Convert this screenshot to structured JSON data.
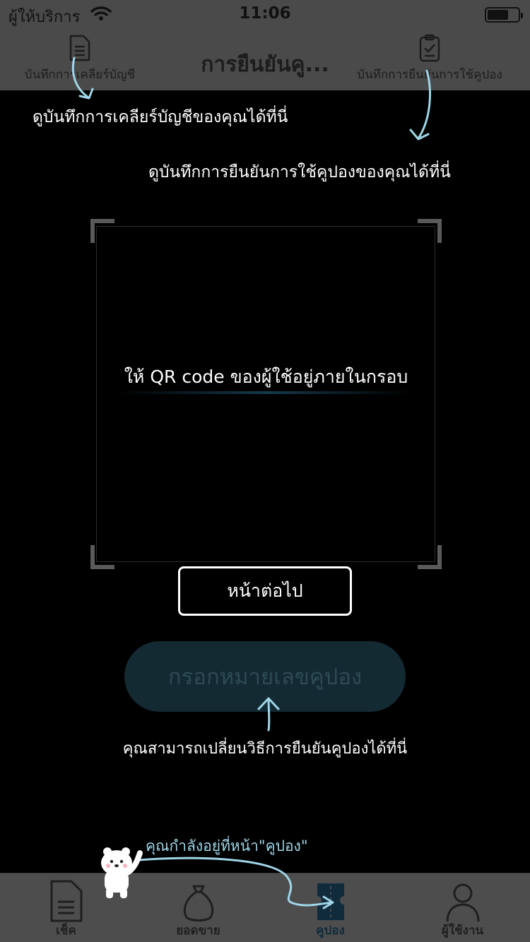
{
  "status_bar": {
    "carrier": "ผู้ให้บริการ",
    "time": "11:06",
    "battery_level_percent": 70
  },
  "nav": {
    "title": "การยืนยันคู...",
    "left_button_label": "บันทึกการเคลียร์บัญชี",
    "right_button_label": "บันทึกการยืนยันการใช้คูปอง",
    "left_icon": "document-icon",
    "right_icon": "clipboard-check-icon"
  },
  "hints": {
    "clear_records": "ดูบันทึกการเคลียร์บัญชีของคุณได้ที่นี่",
    "coupon_records": "ดูบันทึกการยืนยันการใช้คูปองของคุณได้ที่นี่",
    "change_method": "คุณสามารถเปลี่ยนวิธีการยืนยันคูปองได้ที่นี่",
    "current_page": "คุณกำลังอยู่ที่หน้า\"คูปอง\""
  },
  "scanner": {
    "instruction": "ให้ QR code ของผู้ใช้อยู่ภายในกรอบ"
  },
  "buttons": {
    "next": "หน้าต่อไป",
    "enter_coupon": "กรอกหมายเลขคูปอง"
  },
  "tabs": [
    {
      "label": "เช็ค",
      "icon": "document-icon",
      "active": false
    },
    {
      "label": "ยอดขาย",
      "icon": "money-bag-icon",
      "active": false
    },
    {
      "label": "คูปอง",
      "icon": "ticket-icon",
      "active": true
    },
    {
      "label": "ผู้ใช้งาน",
      "icon": "user-icon",
      "active": false
    }
  ],
  "colors": {
    "overlay_header": "#4a4a4a",
    "hint_accent": "#9fd6e8",
    "coupon_button_bg": "#142a33",
    "active_tab": "#0f2b3c"
  }
}
